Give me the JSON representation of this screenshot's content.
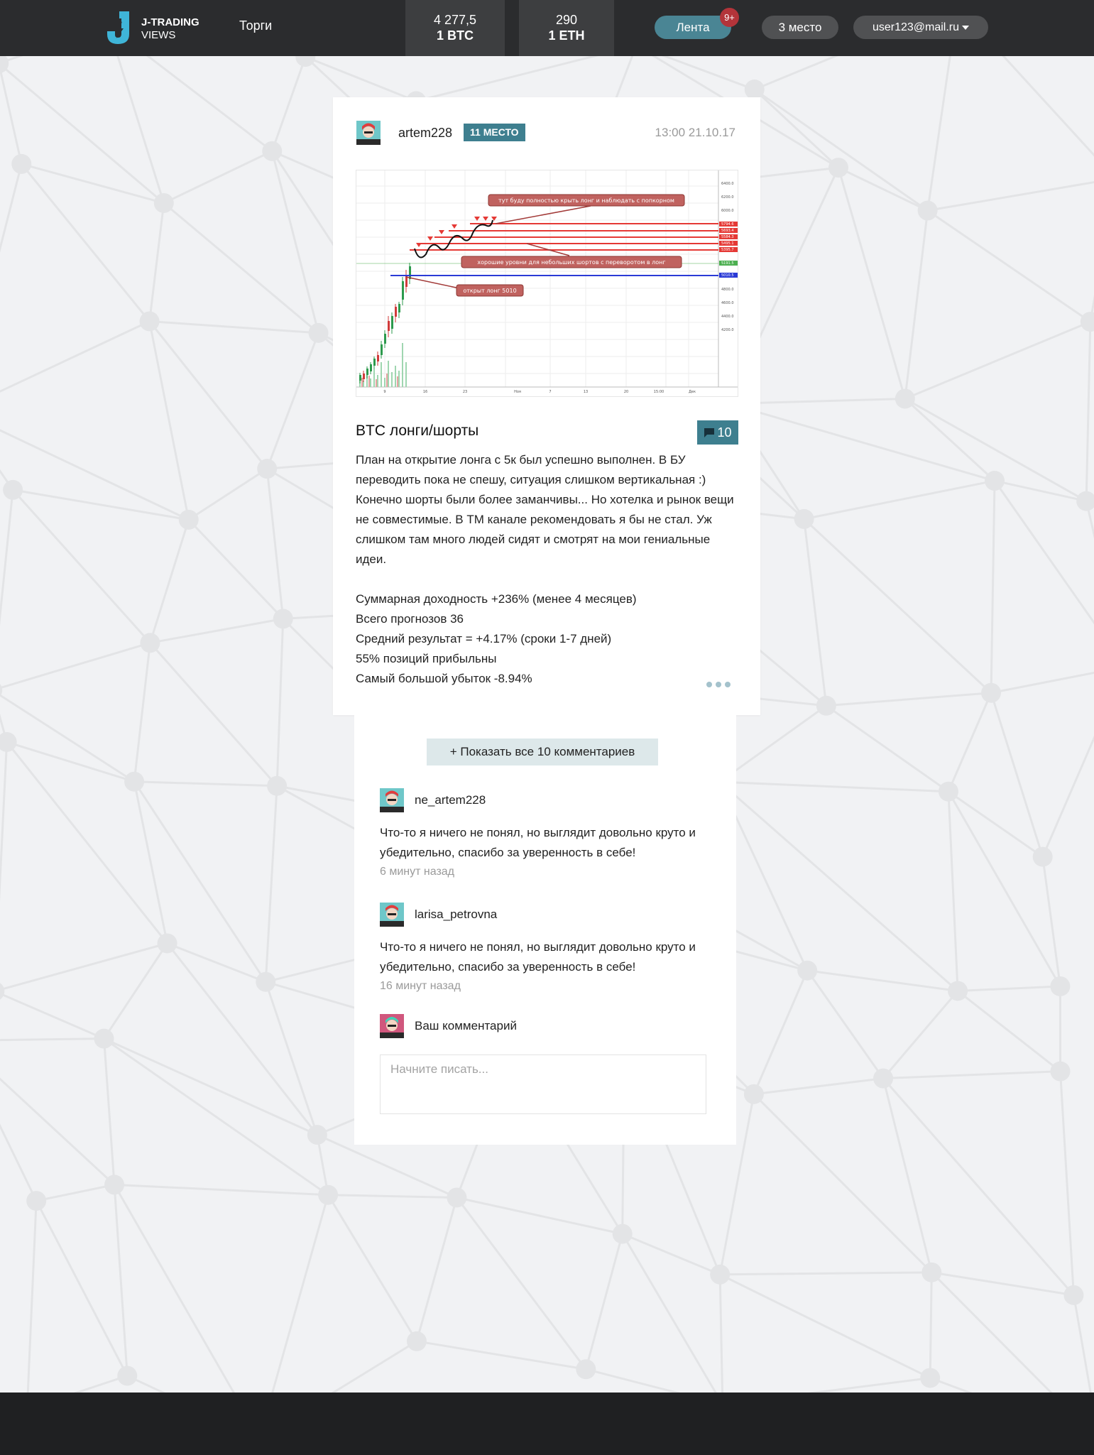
{
  "header": {
    "logo": {
      "line1": "J-TRADING",
      "line2": "VIEWS",
      "icon": "j-logo-icon"
    },
    "nav_trades": "Торги",
    "rates": [
      {
        "value": "4 277,5",
        "coin": "1 BTC"
      },
      {
        "value": "290",
        "coin": "1 ETH"
      }
    ],
    "feed_label": "Лента",
    "feed_badge": "9+",
    "place_label": "3 место",
    "user_label": "user123@mail.ru"
  },
  "post": {
    "author": "artem228",
    "rank": "11 МЕСТО",
    "time": "13:00 21.10.17",
    "title": "BTC лонги/шорты",
    "comments_count": "10",
    "paragraphs": [
      "План на открытие лонга с 5к был успешно выполнен. В БУ переводить пока не спешу, ситуация слишком вертикальная :) Конечно шорты были более заманчивы... Но хотелка и рынок вещи не совместимые. В ТМ канале рекомендовать я бы не стал. Уж слишком там много людей сидят и смотрят на мои гениальные идеи."
    ],
    "stats": [
      "Суммарная доходность +236% (менее 4 месяцев)",
      "Всего прогнозов 36",
      "Средний результат = +4.17% (сроки 1-7 дней)",
      "55% позиций прибыльны",
      "Самый большой убыток -8.94%"
    ]
  },
  "chart_image": {
    "annotations": [
      "тут буду полностью крыть лонг и наблюдать с попкорном",
      "хорошие уровни для небольших шортов с переворотом в лонг",
      "открыт лонг 5010"
    ],
    "price_axis": [
      "6400.0",
      "6200.0",
      "6000.0",
      "5794.6",
      "5693.4",
      "5584.3",
      "5495.1",
      "5395.7",
      "5191.5",
      "5010.5",
      "4800.0",
      "4600.0",
      "4400.0",
      "4200.0"
    ],
    "time_axis": [
      "9",
      "16",
      "23",
      "Ноя",
      "7",
      "13",
      "20",
      "15:00",
      "Дек"
    ],
    "colors": {
      "resistance": "#e53935",
      "entry": "#2a3ad6",
      "support": "#4caf50",
      "callout": "#c0625f"
    }
  },
  "comments": {
    "show_all": "+ Показать все 10 комментариев",
    "items": [
      {
        "author": "ne_artem228",
        "text": "Что-то я ничего не понял, но выглядит довольно круто и убедительно, спасибо за уверенность в себе!",
        "time": "6 минут назад"
      },
      {
        "author": "larisa_petrovna",
        "text": "Что-то я ничего не понял, но выглядит довольно круто и убедительно, спасибо за уверенность в себе!",
        "time": "16 минут назад"
      }
    ],
    "your_comment_label": "Ваш комментарий",
    "input_placeholder": "Начните писать..."
  },
  "colors": {
    "header_bg": "#2b2c2e",
    "accent": "#3e7f8f",
    "feed_pill": "#4a8594",
    "badge": "#b3343a",
    "footer_bg": "#1f2022"
  }
}
